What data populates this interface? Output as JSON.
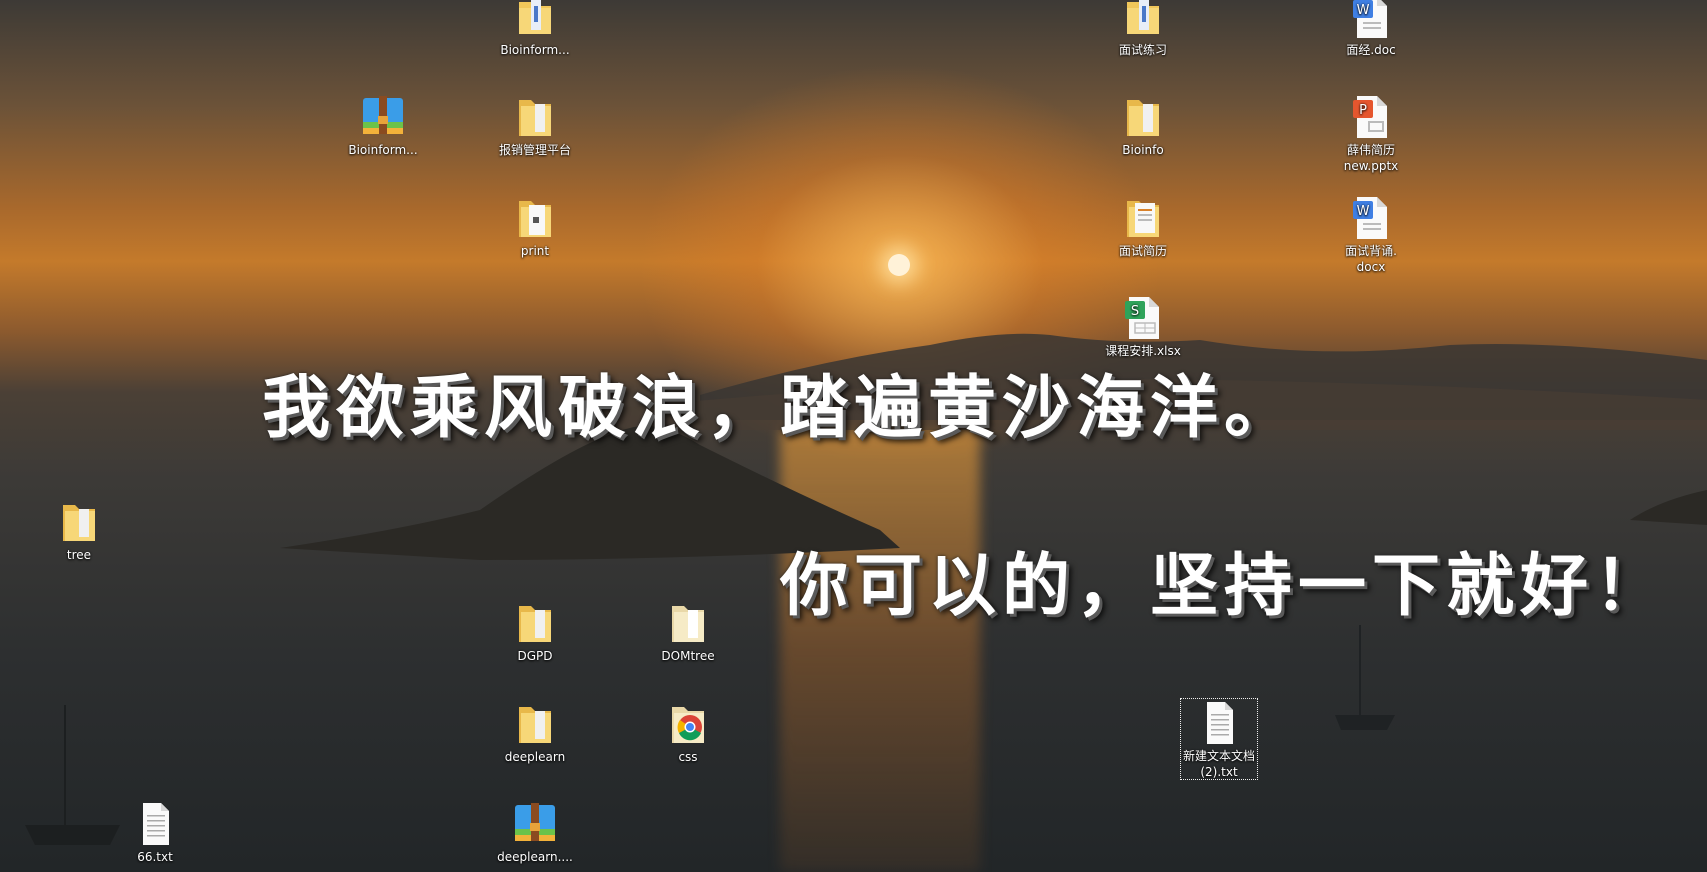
{
  "desktop": {
    "slogans": {
      "line1": "我欲乘风破浪，踏遍黄沙海洋。",
      "line2": "你可以的，坚持一下就好！"
    },
    "icons": [
      {
        "id": "bioinform-folder",
        "label": "Bioinform...",
        "type": "folder-zip"
      },
      {
        "id": "mianshi-lianxi",
        "label": "面试练习",
        "type": "folder-zip"
      },
      {
        "id": "mianjing-doc",
        "label": "面经.doc",
        "type": "word"
      },
      {
        "id": "bioinform-zip",
        "label": "Bioinform...",
        "type": "winrar"
      },
      {
        "id": "baoxiao",
        "label": "报销管理平台",
        "type": "folder"
      },
      {
        "id": "bioinfo",
        "label": "Bioinfo",
        "type": "folder"
      },
      {
        "id": "xuewei-pptx",
        "label": "薛伟简历\nnew.pptx",
        "type": "ppt"
      },
      {
        "id": "print",
        "label": "print",
        "type": "folder-doc"
      },
      {
        "id": "mianshi-jianli",
        "label": "面试简历",
        "type": "folder-doc"
      },
      {
        "id": "mianshi-beisong",
        "label": "面试背诵.\ndocx",
        "type": "word"
      },
      {
        "id": "kecheng-xlsx",
        "label": "课程安排.xlsx",
        "type": "excel"
      },
      {
        "id": "tree",
        "label": "tree",
        "type": "folder"
      },
      {
        "id": "dgpd",
        "label": "DGPD",
        "type": "folder"
      },
      {
        "id": "domtree",
        "label": "DOMtree",
        "type": "folder-light"
      },
      {
        "id": "deeplearn",
        "label": "deeplearn",
        "type": "folder"
      },
      {
        "id": "css",
        "label": "css",
        "type": "chrome"
      },
      {
        "id": "new-txt",
        "label": "新建文本文档\n(2).txt",
        "type": "txt"
      },
      {
        "id": "txt66",
        "label": "66.txt",
        "type": "txt"
      },
      {
        "id": "deeplearn-zip",
        "label": "deeplearn....",
        "type": "winrar"
      }
    ]
  }
}
